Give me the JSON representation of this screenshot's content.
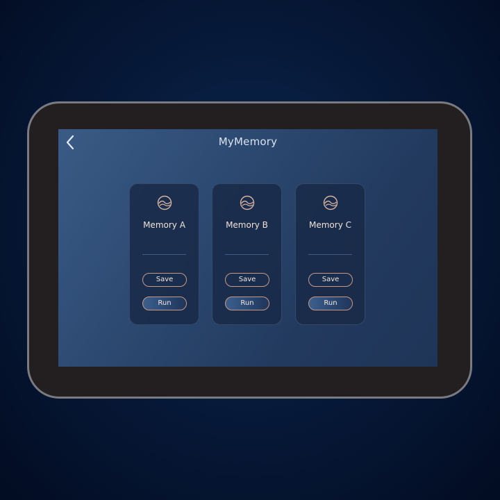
{
  "header": {
    "title": "MyMemory",
    "back_icon": "chevron-left-icon"
  },
  "memories": [
    {
      "name": "Memory A",
      "icon": "wave-circle-icon",
      "save_label": "Save",
      "run_label": "Run"
    },
    {
      "name": "Memory B",
      "icon": "wave-circle-icon",
      "save_label": "Save",
      "run_label": "Run"
    },
    {
      "name": "Memory C",
      "icon": "wave-circle-icon",
      "save_label": "Save",
      "run_label": "Run"
    }
  ],
  "colors": {
    "accent_border": "#c79a86",
    "text_title": "#dbe3ee",
    "text_card": "#f0e2d6"
  }
}
